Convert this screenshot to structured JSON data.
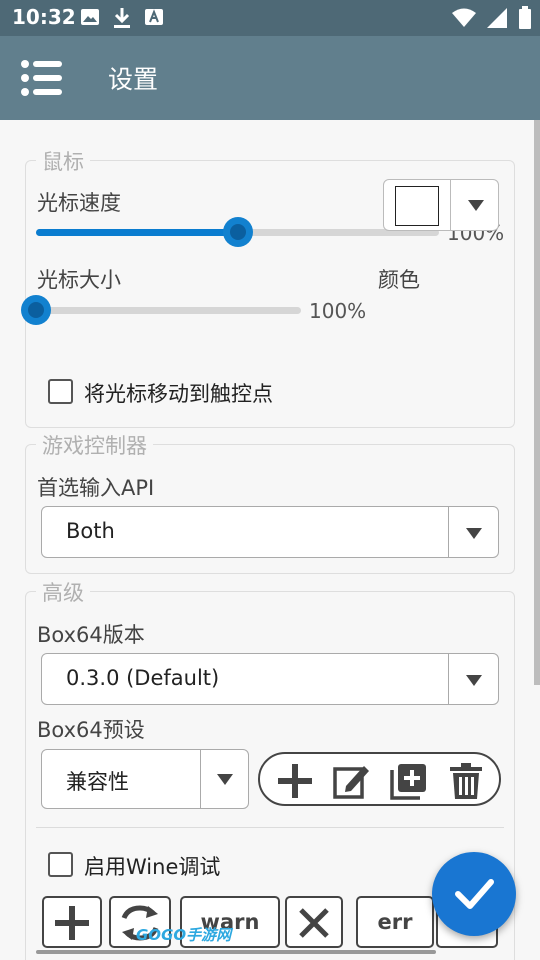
{
  "status_bar": {
    "time": "10:32",
    "left_icons": [
      "image-icon",
      "download-icon",
      "font-icon"
    ],
    "right_icons": [
      "wifi-icon",
      "signal-icon",
      "battery-icon"
    ]
  },
  "app_bar": {
    "title": "设置",
    "menu_icon": "menu-icon",
    "background": "#617f8d"
  },
  "mouse": {
    "title": "鼠标",
    "cursor_speed": {
      "label": "光标速度",
      "value_text": "100%",
      "level": 0.5
    },
    "cursor_size": {
      "label": "光标大小",
      "value_text": "100%",
      "level": 0.0
    },
    "color": {
      "label": "颜色",
      "value": "#ffffff"
    },
    "move_to_touch": {
      "label": "将光标移动到触控点",
      "checked": false
    }
  },
  "game_controller": {
    "title": "游戏控制器",
    "preferred_api_label": "首选输入API",
    "preferred_api_value": "Both"
  },
  "advanced": {
    "title": "高级",
    "box64_version_label": "Box64版本",
    "box64_version_value": "0.3.0 (Default)",
    "box64_preset_label": "Box64预设",
    "box64_preset_value": "兼容性",
    "preset_tools": [
      "add-icon",
      "edit-icon",
      "duplicate-icon",
      "delete-icon"
    ],
    "wine_debug": {
      "label": "启用Wine调试",
      "checked": false
    },
    "debug_buttons": [
      "warn",
      "err"
    ]
  },
  "fab": {
    "icon": "check-icon",
    "color": "#1976d2"
  },
  "watermark": "GOGO手游网",
  "accent_color": "#0a7ccf"
}
